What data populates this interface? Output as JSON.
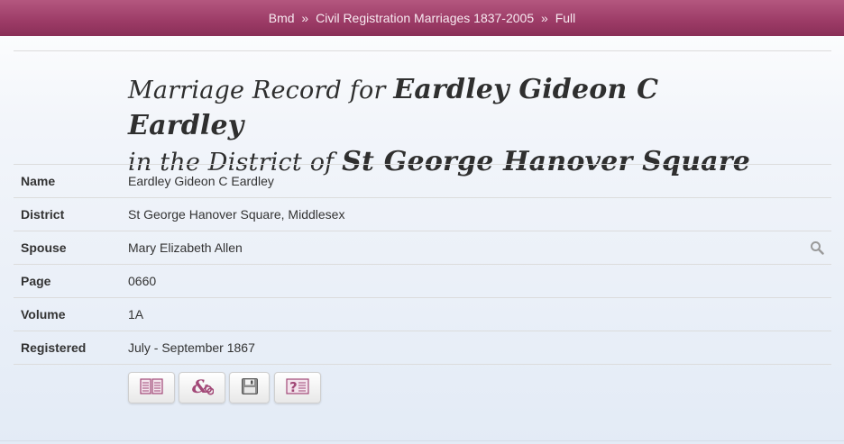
{
  "breadcrumb": {
    "root": "Bmd",
    "section": "Civil Registration Marriages 1837-2005",
    "current": "Full",
    "separator": "»"
  },
  "title": {
    "prefix1": "Marriage Record for",
    "name": "Eardley Gideon C Eardley",
    "prefix2": "in the District of",
    "district": "St George Hanover Square"
  },
  "record": {
    "rows": [
      {
        "label": "Name",
        "value": "Eardley Gideon C Eardley"
      },
      {
        "label": "District",
        "value": "St George Hanover Square, Middlesex"
      },
      {
        "label": "Spouse",
        "value": "Mary Elizabeth Allen"
      },
      {
        "label": "Page",
        "value": "0660"
      },
      {
        "label": "Volume",
        "value": "1A"
      },
      {
        "label": "Registered",
        "value": "July - September 1867"
      }
    ]
  },
  "actions": {
    "icons": [
      "view-record-icon",
      "link-spouse-icon",
      "save-icon",
      "help-record-icon"
    ]
  },
  "colors": {
    "header": "#9c3b66",
    "icon_accent": "#a24877"
  }
}
